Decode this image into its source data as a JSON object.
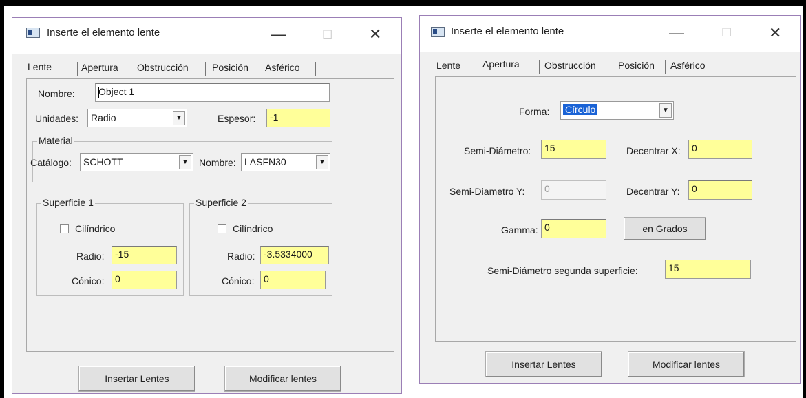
{
  "left_window": {
    "title": "Inserte el elemento lente",
    "minimize": "—",
    "maximize": "☐",
    "close": "✕",
    "tabs": [
      "Lente",
      "Apertura",
      "Obstrucción",
      "Posición",
      "Asférico"
    ],
    "nombre_label": "Nombre:",
    "nombre_value": "Object 1",
    "unidades_label": "Unidades:",
    "unidades_value": "Radio",
    "espesor_label": "Espesor:",
    "espesor_value": "-1",
    "material_title": "Material",
    "catalogo_label": "Catálogo:",
    "catalogo_value": "SCHOTT",
    "nombre_mat_label": "Nombre:",
    "nombre_mat_value": "LASFN30",
    "surface1": {
      "title": "Superficie 1",
      "cyl_label": "Cilíndrico",
      "radio_label": "Radio:",
      "radio_value": "-15",
      "conico_label": "Cónico:",
      "conico_value": "0"
    },
    "surface2": {
      "title": "Superficie 2",
      "cyl_label": "Cilíndrico",
      "radio_label": "Radio:",
      "radio_value": "-3.5334000",
      "conico_label": "Cónico:",
      "conico_value": "0"
    },
    "insert_button": "Insertar Lentes",
    "modify_button": "Modificar lentes"
  },
  "right_window": {
    "title": "Inserte el elemento lente",
    "minimize": "—",
    "maximize": "☐",
    "close": "✕",
    "tabs": [
      "Lente",
      "Apertura",
      "Obstrucción",
      "Posición",
      "Asférico"
    ],
    "forma_label": "Forma:",
    "forma_value": "Círculo",
    "semi_diam_label": "Semi-Diámetro:",
    "semi_diam_value": "15",
    "decx_label": "Decentrar X:",
    "decx_value": "0",
    "semi_diam_y_label": "Semi-Diametro Y:",
    "semi_diam_y_value": "0",
    "decy_label": "Decentrar Y:",
    "decy_value": "0",
    "gamma_label": "Gamma:",
    "gamma_value": "0",
    "grados_button": "en Grados",
    "semi_diam2_label": "Semi-Diámetro segunda superficie:",
    "semi_diam2_value": "15",
    "insert_button": "Insertar Lentes",
    "modify_button": "Modificar lentes"
  },
  "colors": {
    "field_yellow": "#ffff99",
    "selection_blue": "#1a63d6",
    "dialog_gray": "#f0f0f0"
  }
}
